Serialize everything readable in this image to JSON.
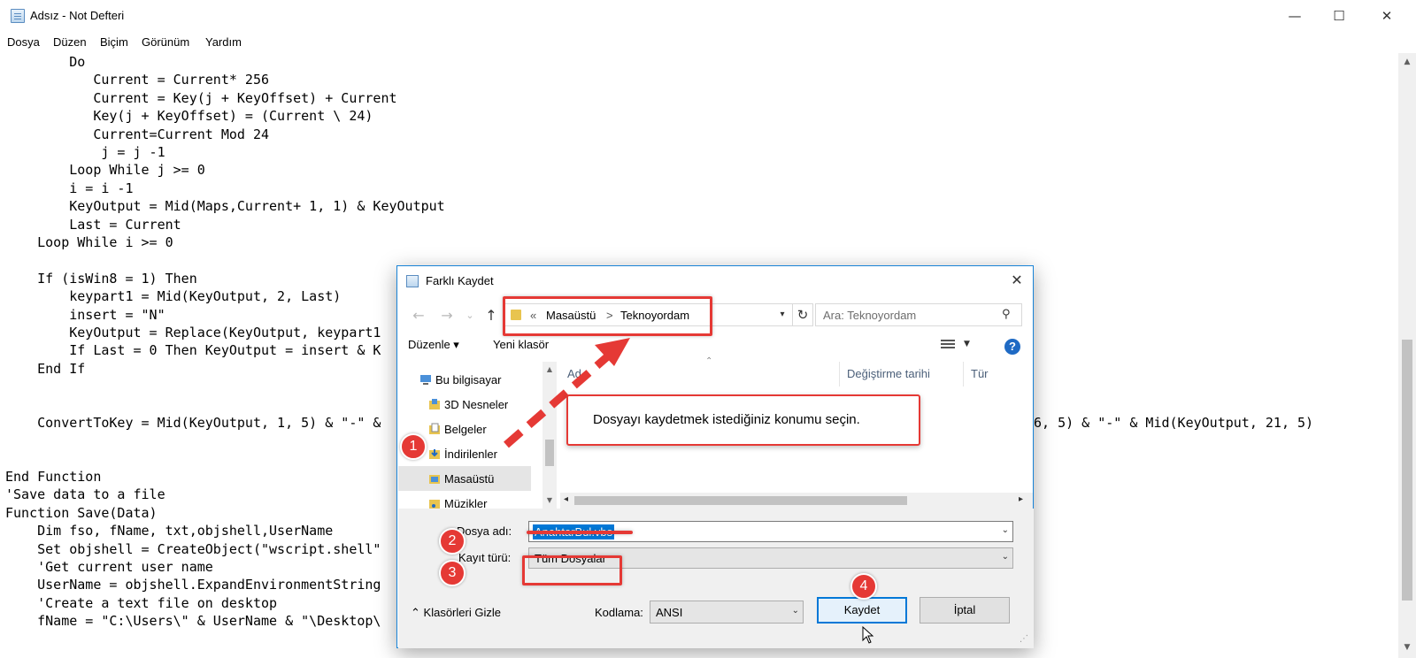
{
  "notepad": {
    "title": "Adsız - Not Defteri",
    "window_controls": {
      "minimize": "—",
      "maximize": "☐",
      "close": "✕"
    },
    "menu": [
      "Dosya",
      "Düzen",
      "Biçim",
      "Görünüm",
      "Yardım"
    ],
    "code_lines": [
      "        Do",
      "           Current = Current* 256",
      "           Current = Key(j + KeyOffset) + Current",
      "           Key(j + KeyOffset) = (Current \\ 24)",
      "           Current=Current Mod 24",
      "            j = j -1",
      "        Loop While j >= 0",
      "        i = i -1",
      "        KeyOutput = Mid(Maps,Current+ 1, 1) & KeyOutput",
      "        Last = Current",
      "    Loop While i >= 0",
      "",
      "    If (isWin8 = 1) Then",
      "        keypart1 = Mid(KeyOutput, 2, Last)",
      "        insert = \"N\"",
      "        KeyOutput = Replace(KeyOutput, keypart1",
      "        If Last = 0 Then KeyOutput = insert & K",
      "    End If",
      "",
      "",
      "    ConvertToKey = Mid(KeyOutput, 1, 5) & \"-\" &",
      "",
      "",
      "End Function",
      "'Save data to a file",
      "Function Save(Data)",
      "    Dim fso, fName, txt,objshell,UserName",
      "    Set objshell = CreateObject(\"wscript.shell\"",
      "    'Get current user name",
      "    UserName = objshell.ExpandEnvironmentString",
      "    'Create a text file on desktop",
      "    fName = \"C:\\Users\\\" & UserName & \"\\Desktop\\"
    ],
    "code_line_right_fragment": "6, 5) & \"-\" & Mid(KeyOutput, 21, 5)"
  },
  "dialog": {
    "title": "Farklı Kaydet",
    "close": "✕",
    "nav": {
      "back": "←",
      "forward": "→",
      "recent": "⌄",
      "up": "↑"
    },
    "address": {
      "prefix": "«",
      "parts": [
        "Masaüstü",
        "Teknoyordam"
      ],
      "separator": ">"
    },
    "search_placeholder": "Ara: Teknoyordam",
    "toolbar": {
      "organize": "Düzenle ▾",
      "new_folder": "Yeni klasör",
      "help": "?"
    },
    "nav_items": [
      "Bu bilgisayar",
      "3D Nesneler",
      "Belgeler",
      "İndirilenler",
      "Masaüstü",
      "Müzikler"
    ],
    "selected_nav": "Masaüstü",
    "columns": [
      "Ad",
      "Değiştirme tarihi",
      "Tür"
    ],
    "filename_label": "Dosya adı:",
    "filename_value": "AnahtarBul.vbs",
    "filetype_label": "Kayıt türü:",
    "filetype_value": "Tüm Dosyalar",
    "hide_folders": "Klasörleri Gizle",
    "encoding_label": "Kodlama:",
    "encoding_value": "ANSI",
    "save_button": "Kaydet",
    "cancel_button": "İptal"
  },
  "annotations": {
    "callout_text": "Dosyayı kaydetmek istediğiniz konumu seçin.",
    "steps": [
      "1",
      "2",
      "3",
      "4"
    ],
    "accent_color": "#e53935"
  }
}
